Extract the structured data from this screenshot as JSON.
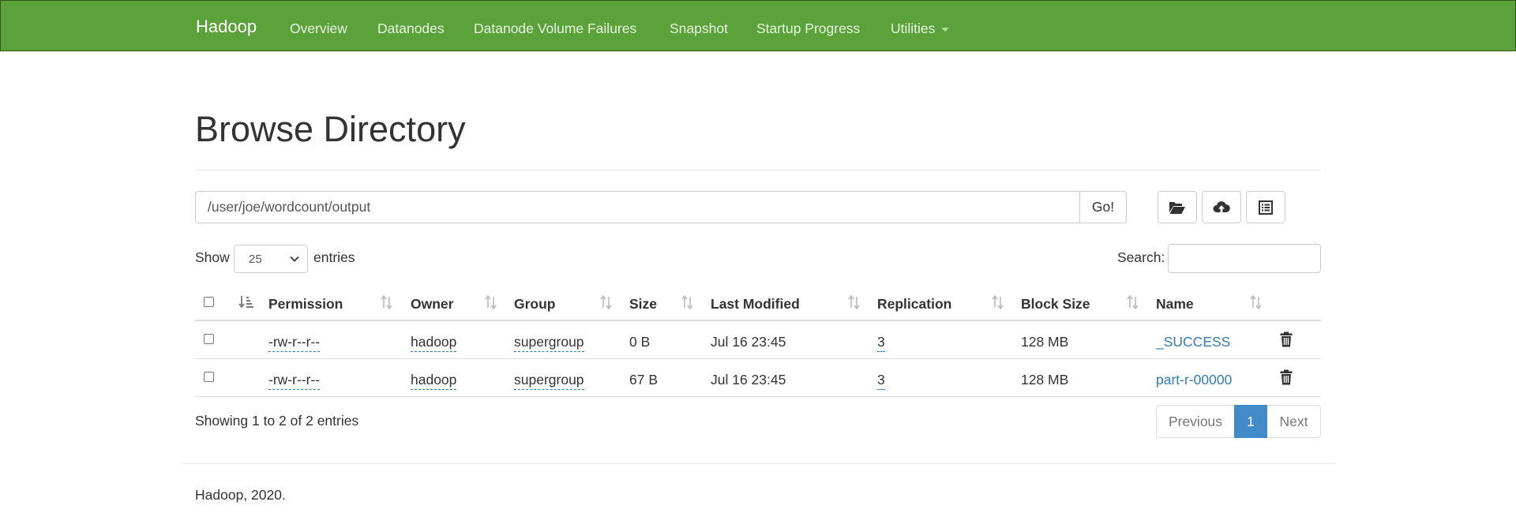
{
  "nav": {
    "brand": "Hadoop",
    "items": [
      "Overview",
      "Datanodes",
      "Datanode Volume Failures",
      "Snapshot",
      "Startup Progress",
      "Utilities"
    ]
  },
  "page": {
    "title": "Browse Directory"
  },
  "path": {
    "value": "/user/joe/wordcount/output",
    "go_label": "Go!"
  },
  "toolbar": {
    "icons": [
      "folder-open-icon",
      "cloud-upload-icon",
      "list-alt-icon"
    ]
  },
  "table_controls": {
    "show_label": "Show",
    "entries_value": "25",
    "entries_label": "entries",
    "search_label": "Search:"
  },
  "table": {
    "columns": [
      "Permission",
      "Owner",
      "Group",
      "Size",
      "Last Modified",
      "Replication",
      "Block Size",
      "Name"
    ],
    "rows": [
      {
        "permission": "-rw-r--r--",
        "owner": "hadoop",
        "group": "supergroup",
        "size": "0 B",
        "modified": "Jul 16 23:45",
        "replication": "3",
        "block_size": "128 MB",
        "name": "_SUCCESS"
      },
      {
        "permission": "-rw-r--r--",
        "owner": "hadoop",
        "group": "supergroup",
        "size": "67 B",
        "modified": "Jul 16 23:45",
        "replication": "3",
        "block_size": "128 MB",
        "name": "part-r-00000"
      }
    ]
  },
  "footer_info": {
    "showing": "Showing 1 to 2 of 2 entries",
    "previous": "Previous",
    "page": "1",
    "next": "Next"
  },
  "footer": {
    "text": "Hadoop, 2020."
  },
  "colors": {
    "navbar_bg": "#5ba23a",
    "link": "#337ab7",
    "active_page": "#428bca"
  }
}
